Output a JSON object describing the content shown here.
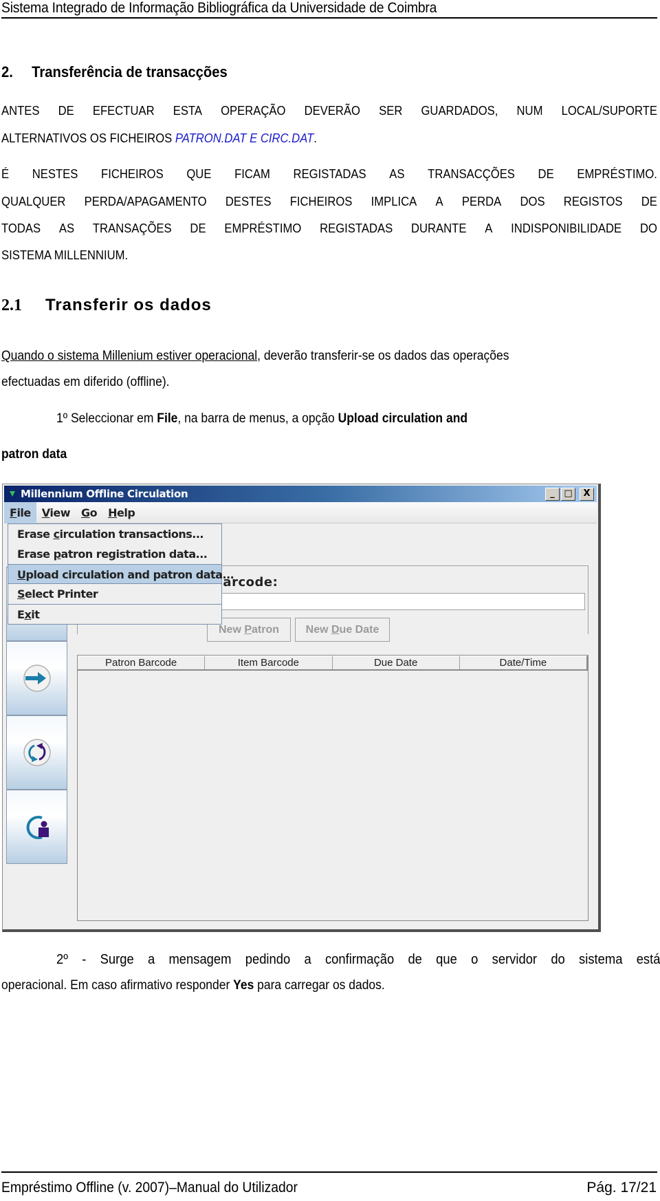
{
  "header": {
    "title": "Sistema Integrado de Informação Bibliográfica da Universidade de Coimbra"
  },
  "section": {
    "number": "2.",
    "title": "Transferência de transacções"
  },
  "warning": {
    "line1_words": [
      "ANTES",
      "DE",
      "EFECTUAR",
      "ESTA",
      "OPERAÇÃO",
      "DEVERÃO",
      "SER",
      "GUARDADOS,",
      "NUM",
      "LOCAL/SUPORTE"
    ],
    "line2_prefix": "ALTERNATIVOS OS FICHEIROS ",
    "file1": "PATRON.DAT",
    "conj": " E ",
    "file2": "CIRC.DAT",
    "line2_suffix": ".",
    "line3_words": [
      "É",
      "NESTES",
      "FICHEIROS",
      "QUE",
      "FICAM",
      "REGISTADAS",
      "AS",
      "TRANSACÇÕES",
      "DE",
      "EMPRÉSTIMO."
    ],
    "line4_words": [
      "QUALQUER",
      "PERDA/APAGAMENTO",
      "DESTES",
      "FICHEIROS",
      "IMPLICA",
      "A",
      "PERDA",
      "DOS",
      "REGISTOS",
      "DE"
    ],
    "line5_words": [
      "TODAS",
      "AS",
      "TRANSAÇÕES",
      "DE",
      "EMPRÉSTIMO",
      "REGISTADAS",
      "DURANTE",
      "A",
      "INDISPONIBILIDADE",
      "DO"
    ],
    "line6": "SISTEMA MILLENNIUM."
  },
  "subsection": {
    "number": "2.1",
    "title": "Transferir os dados"
  },
  "intro": {
    "underlined": "Quando o sistema Millenium estiver operacional",
    "rest": ", deverão transferir-se os dados das operações",
    "line2": "efectuadas em diferido  (offline)."
  },
  "step1": {
    "prefix": "1º Seleccionar em ",
    "bold1": "File",
    "middle": ", na barra de menus, a opção ",
    "bold2": "Upload circulation and",
    "bold3": "patron data"
  },
  "app_window": {
    "title": "Millennium Offline Circulation",
    "controls": {
      "minimize": "_",
      "maximize": "□",
      "close": "X"
    },
    "menu": [
      {
        "mnemonic": "F",
        "rest": "ile",
        "active": true
      },
      {
        "mnemonic": "V",
        "rest": "iew"
      },
      {
        "mnemonic": "G",
        "rest": "o"
      },
      {
        "mnemonic": "H",
        "rest": "elp"
      }
    ],
    "file_menu": [
      {
        "pre": "Erase ",
        "mnemonic": "c",
        "post": "irculation transactions..."
      },
      {
        "pre": "Erase ",
        "mnemonic": "p",
        "post": "atron registration data..."
      },
      {
        "pre": "",
        "mnemonic": "U",
        "post": "pload circulation and patron data...",
        "selected": true
      },
      {
        "pre": "",
        "mnemonic": "S",
        "post": "elect Printer"
      },
      {
        "pre": "E",
        "mnemonic": "x",
        "post": "it"
      }
    ],
    "barcode_label": "D Barcode:",
    "barcode_value": "",
    "buttons": [
      {
        "pre": "New ",
        "mnemonic": "P",
        "post": "atron",
        "enabled": false
      },
      {
        "pre": "New ",
        "mnemonic": "D",
        "post": "ue Date",
        "enabled": false
      }
    ],
    "table_columns": [
      "Patron Barcode",
      "Item Barcode",
      "Due Date",
      "Date/Time"
    ],
    "table_rows": [],
    "sidebar_icons": [
      "checkout-arrow-icon",
      "checkin-arrow-icon",
      "renew-icon",
      "patron-registration-icon"
    ],
    "colors": {
      "titlebar_start": "#0a246a",
      "titlebar_end": "#a6caf0",
      "menu_selected": "#b8cfe5",
      "icon_purple": "#3d1478",
      "icon_teal": "#1a7ea8"
    }
  },
  "step2": {
    "line1_words": [
      "2º",
      "-",
      "Surge",
      "a",
      "mensagem",
      "pedindo",
      "a",
      "confirmação",
      "de",
      "que",
      "o",
      "servidor",
      "do",
      "sistema",
      "está"
    ],
    "line2_prefix": "operacional. Em caso afirmativo responder ",
    "bold": "Yes",
    "line2_suffix": " para carregar os dados."
  },
  "footer": {
    "left": "Empréstimo Offline (v. 2007)–Manual do Utilizador",
    "right": "Pág. 17/21"
  }
}
